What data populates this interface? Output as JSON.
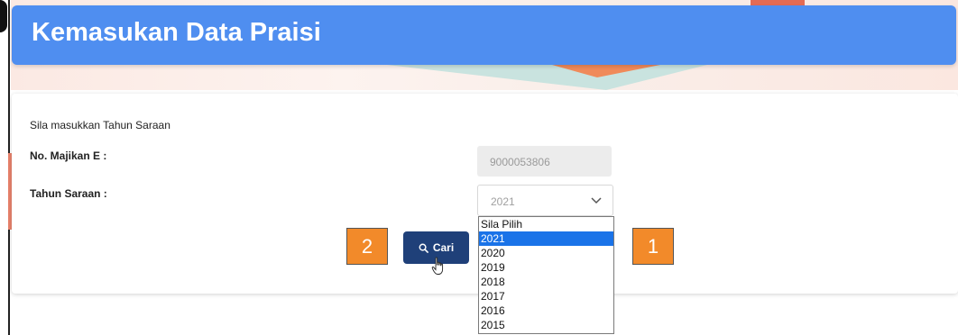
{
  "header": {
    "title": "Kemasukan Data Praisi"
  },
  "form": {
    "intro": "Sila masukkan Tahun Saraan",
    "majikan_label": "No. Majikan E :",
    "majikan_value": "9000053806",
    "tahun_label": "Tahun Saraan :",
    "tahun_value": "2021",
    "search_button": "Cari"
  },
  "dropdown": {
    "options": [
      "Sila Pilih",
      "2021",
      "2020",
      "2019",
      "2018",
      "2017",
      "2016",
      "2015"
    ],
    "selected": "2021"
  },
  "callouts": {
    "first": "1",
    "second": "2"
  },
  "icons": {
    "search": "search-icon",
    "chevron": "chevron-down-icon",
    "cursor": "hand-pointer-icon"
  },
  "colors": {
    "header": "#4f8ef0",
    "button": "#1f4079",
    "callout": "#f28a2a",
    "selected_option": "#1a73e8"
  }
}
